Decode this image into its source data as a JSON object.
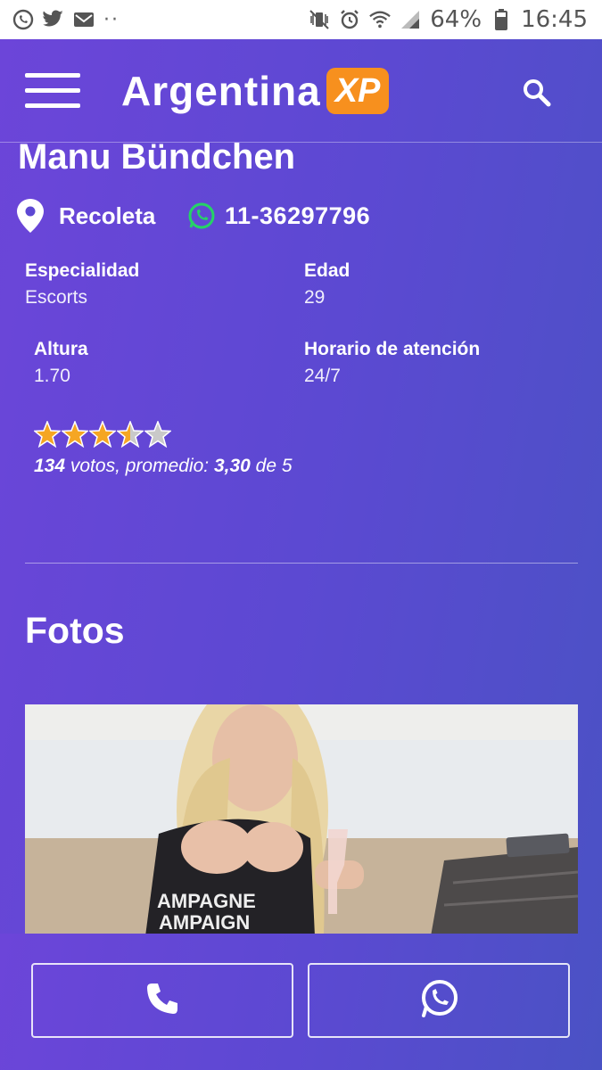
{
  "status_bar": {
    "left_icons": [
      "whatsapp-icon",
      "twitter-icon",
      "mail-icon",
      "more-dots-icon"
    ],
    "right_icons": [
      "vibrate-mute-icon",
      "alarm-icon",
      "wifi-icon",
      "signal-icon",
      "battery-icon"
    ],
    "battery": "64%",
    "time": "16:45"
  },
  "header": {
    "logo_text": "Argentina",
    "logo_badge": "XP",
    "logo_badge_color": "#f7901e"
  },
  "profile": {
    "name": "Manu Bündchen",
    "location": "Recoleta",
    "phone": "11-36297796",
    "fields": [
      {
        "label": "Especialidad",
        "value": "Escorts"
      },
      {
        "label": "Edad",
        "value": "29"
      },
      {
        "label": "Altura",
        "value": "1.70"
      },
      {
        "label": "Horario de atención",
        "value": "24/7"
      }
    ],
    "rating": {
      "stars_filled": 3.5,
      "stars_total": 5,
      "votes_count": "134",
      "votes_text": " votos, promedio: ",
      "average": "3,30",
      "of_text": " de 5"
    }
  },
  "photos_section": {
    "title": "Fotos"
  },
  "actions": {
    "call_icon": "phone-icon",
    "whatsapp_icon": "whatsapp-icon"
  },
  "colors": {
    "primary_gradient_start": "#6c45d9",
    "primary_gradient_end": "#4a52c4",
    "whatsapp_green": "#25d366",
    "star_gold": "#f5a623"
  }
}
